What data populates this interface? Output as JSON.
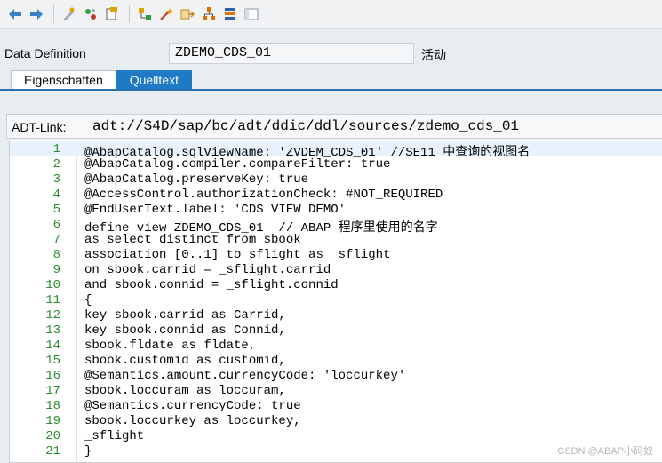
{
  "toolbar": {
    "icons": [
      "back-icon",
      "forward-icon",
      "toggle-change-icon",
      "activate-icon",
      "copy-icon",
      "hierarchy-icon",
      "wizard-icon",
      "navigate-icon",
      "tree-icon",
      "stack-icon",
      "layout-icon"
    ]
  },
  "definition": {
    "label": "Data Definition",
    "name": "ZDEMO_CDS_01",
    "status": "活动"
  },
  "tabs": [
    {
      "label": "Eigenschaften",
      "active": false
    },
    {
      "label": "Quelltext",
      "active": true
    }
  ],
  "adt": {
    "label": "ADT-Link:",
    "value": "adt://S4D/sap/bc/adt/ddic/ddl/sources/zdemo_cds_01"
  },
  "code_lines": [
    {
      "n": "1",
      "text": "@AbapCatalog.sqlViewName: 'ZVDEM_CDS_01' //SE11 中查询的视图名"
    },
    {
      "n": "2",
      "text": "@AbapCatalog.compiler.compareFilter: true"
    },
    {
      "n": "3",
      "text": "@AbapCatalog.preserveKey: true"
    },
    {
      "n": "4",
      "text": "@AccessControl.authorizationCheck: #NOT_REQUIRED"
    },
    {
      "n": "5",
      "text": "@EndUserText.label: 'CDS VIEW DEMO'"
    },
    {
      "n": "6",
      "text": "define view ZDEMO_CDS_01  // ABAP 程序里使用的名字"
    },
    {
      "n": "7",
      "text": "as select distinct from sbook"
    },
    {
      "n": "8",
      "text": "association [0..1] to sflight as _sflight"
    },
    {
      "n": "9",
      "text": "on sbook.carrid = _sflight.carrid"
    },
    {
      "n": "10",
      "text": "and sbook.connid = _sflight.connid"
    },
    {
      "n": "11",
      "text": "{"
    },
    {
      "n": "12",
      "text": "key sbook.carrid as Carrid,"
    },
    {
      "n": "13",
      "text": "key sbook.connid as Connid,"
    },
    {
      "n": "14",
      "text": "sbook.fldate as fldate,"
    },
    {
      "n": "15",
      "text": "sbook.customid as customid,"
    },
    {
      "n": "16",
      "text": "@Semantics.amount.currencyCode: 'loccurkey'"
    },
    {
      "n": "17",
      "text": "sbook.loccuram as loccuram,"
    },
    {
      "n": "18",
      "text": "@Semantics.currencyCode: true"
    },
    {
      "n": "19",
      "text": "sbook.loccurkey as loccurkey,"
    },
    {
      "n": "20",
      "text": "_sflight"
    },
    {
      "n": "21",
      "text": "}"
    }
  ],
  "watermark": "CSDN @ABAP小码奴",
  "colors": {
    "accent": "#1f7ac5",
    "line_number": "#2e8b2e"
  }
}
